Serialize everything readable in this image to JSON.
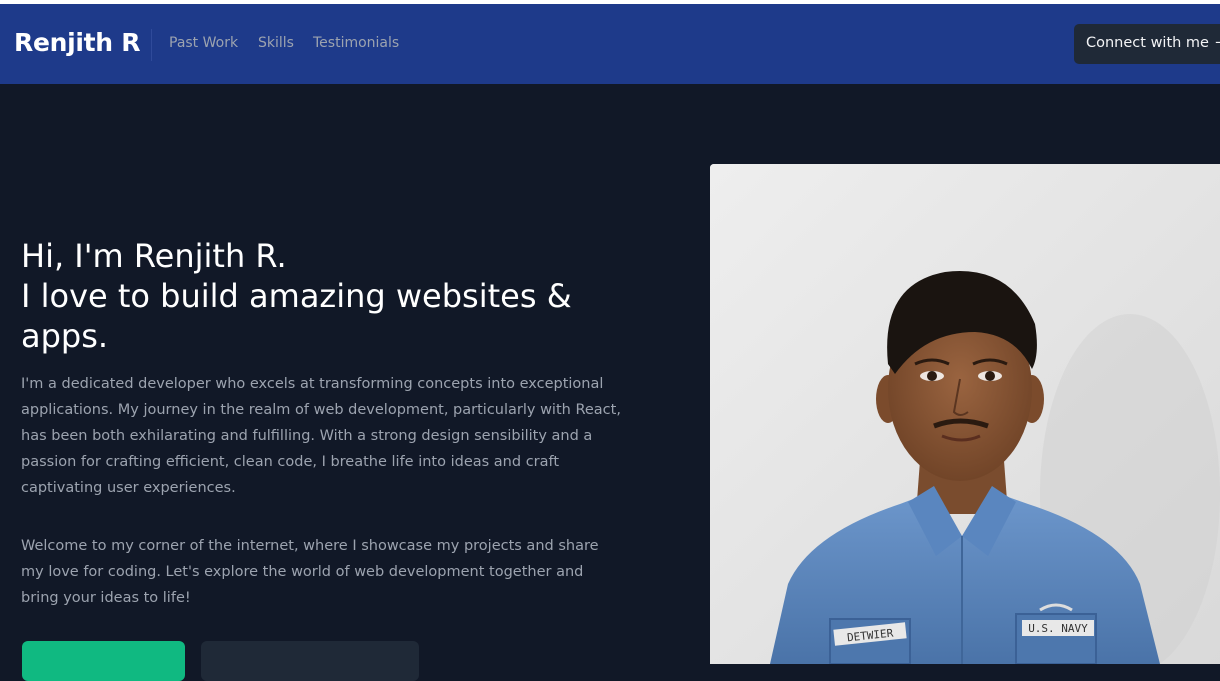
{
  "navbar": {
    "brand": "Renjith R",
    "links": [
      {
        "label": "Past Work"
      },
      {
        "label": "Skills"
      },
      {
        "label": "Testimonials"
      }
    ],
    "cta_label": "Connect with me",
    "cta_arrow": "→"
  },
  "hero": {
    "title_line1": "Hi, I'm Renjith R.",
    "title_line2": "I love to build amazing websites & apps.",
    "paragraph1": "I'm a dedicated developer who excels at transforming concepts into exceptional applications. My journey in the realm of web development, particularly with React, has been both exhilarating and fulfilling. With a strong design sensibility and a passion for crafting efficient, clean code, I breathe life into ideas and craft captivating user experiences.",
    "paragraph2": "Welcome to my corner of the internet, where I showcase my projects and share my love for coding. Let's explore the world of web development together and bring your ideas to life!",
    "photo": {
      "badge_left": "DETWIER",
      "badge_right": "U.S. NAVY"
    }
  },
  "colors": {
    "navbar_bg": "#1e3a8a",
    "page_bg": "#111827",
    "primary_button": "#10b981",
    "secondary_button": "#1f2937"
  }
}
